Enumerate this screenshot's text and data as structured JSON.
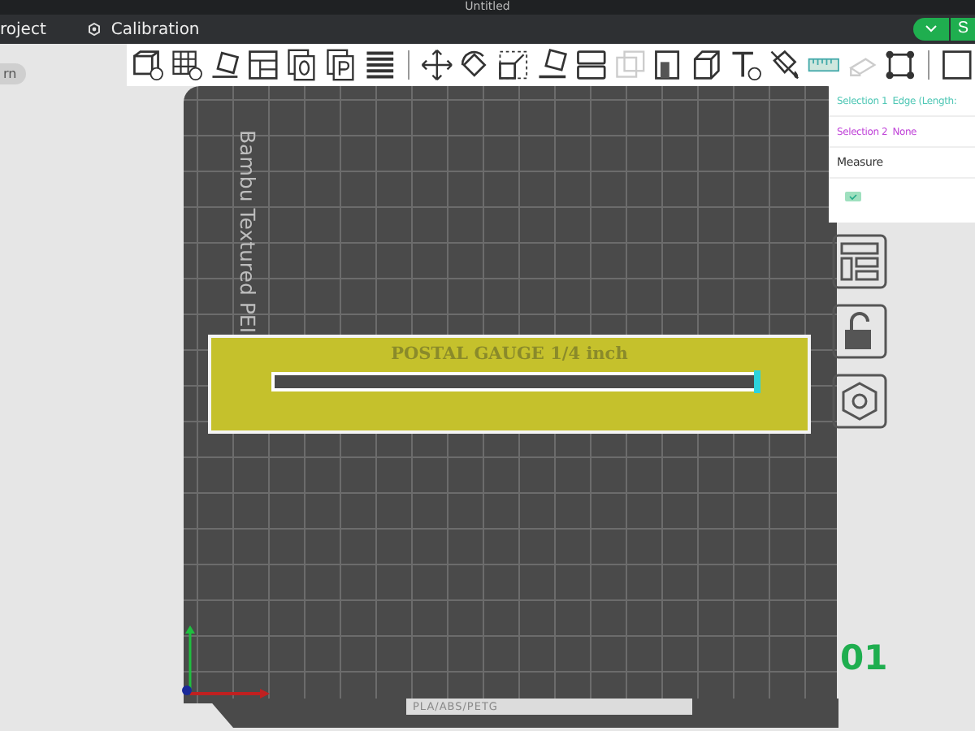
{
  "window": {
    "title": "Untitled"
  },
  "menu": {
    "items": [
      {
        "label": "roject",
        "kind": "plain"
      },
      {
        "label": "Calibration",
        "kind": "icon"
      }
    ],
    "action_button": "S"
  },
  "side_pill": "rn",
  "measure_panel": {
    "selection_1_label": "Selection 1",
    "selection_1_value": "Edge (Length:",
    "selection_2_label": "Selection 2",
    "selection_2_value": "None",
    "title": "Measure"
  },
  "plate": {
    "name": "Bambu Textured PEI",
    "filament": "PLA/ABS/PETG",
    "number": "01"
  },
  "object": {
    "label": "POSTAL GAUGE 1/4 inch",
    "selected": true
  }
}
